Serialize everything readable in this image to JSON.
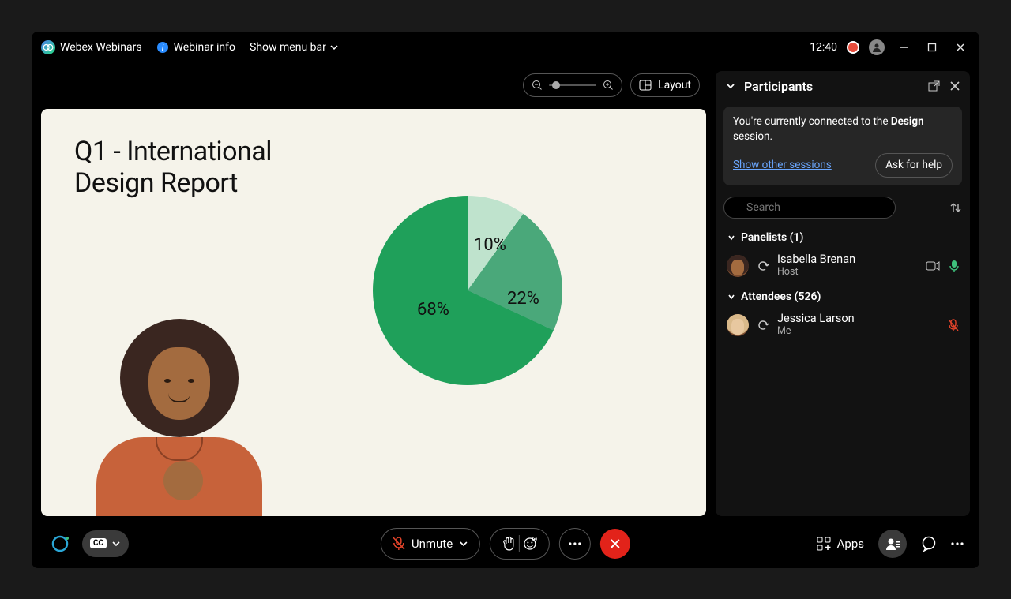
{
  "titlebar": {
    "app_name": "Webex Webinars",
    "info_label": "Webinar info",
    "menu_label": "Show menu bar",
    "clock": "12:40"
  },
  "stage": {
    "layout_label": "Layout"
  },
  "slide": {
    "title_line1": "Q1 -  International",
    "title_line2": "Design Report"
  },
  "chart_data": {
    "type": "pie",
    "title": "",
    "slices": [
      {
        "label": "10%",
        "value": 10,
        "color": "#bfe3cd"
      },
      {
        "label": "22%",
        "value": 22,
        "color": "#4aa87a"
      },
      {
        "label": "68%",
        "value": 68,
        "color": "#1fa05a"
      }
    ]
  },
  "panel": {
    "title": "Participants",
    "info_prefix": "You're currently connected to the ",
    "info_bold": "Design",
    "info_suffix": " session.",
    "show_other": "Show other sessions",
    "help_label": "Ask for help",
    "search_placeholder": "Search",
    "panelists_header": "Panelists (1)",
    "attendees_header": "Attendees (526)",
    "panelists": [
      {
        "name": "Isabella Brenan",
        "role": "Host"
      }
    ],
    "attendees": [
      {
        "name": "Jessica Larson",
        "role": "Me"
      }
    ]
  },
  "bottom": {
    "unmute_label": "Unmute",
    "apps_label": "Apps"
  }
}
